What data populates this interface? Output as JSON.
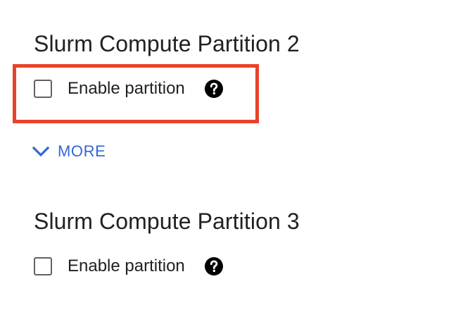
{
  "partitions": [
    {
      "title": "Slurm Compute Partition 2",
      "enable_label": "Enable partition",
      "enabled": false
    },
    {
      "title": "Slurm Compute Partition 3",
      "enable_label": "Enable partition",
      "enabled": false
    }
  ],
  "more_link": {
    "label": "MORE",
    "icon": "chevron-down-icon"
  },
  "colors": {
    "accent": "#3367d6",
    "highlight": "#e8432a",
    "text": "#202124",
    "checkbox_border": "#5f6368"
  }
}
